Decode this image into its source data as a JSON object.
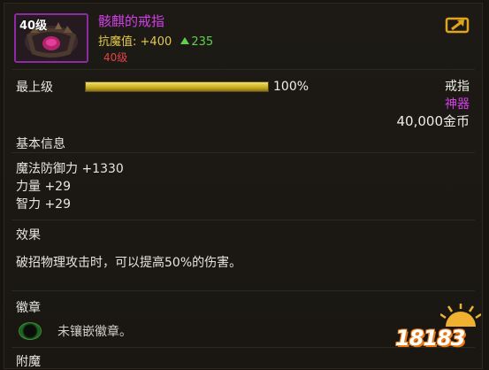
{
  "header": {
    "icon_level": "40级",
    "item_name": "骸麒的戒指",
    "stat_label": "抗魔值:",
    "stat_value": "+400",
    "stat_delta": "235",
    "required_level": "40级"
  },
  "level_row": {
    "label": "最上级",
    "progress": 1.0,
    "percent_text": "100%"
  },
  "item_info": {
    "type": "戒指",
    "rarity": "神器",
    "price": "40,000金币"
  },
  "basic_info": {
    "title": "基本信息",
    "attributes": [
      "魔法防御力 +1330",
      "力量 +29",
      "智力 +29"
    ]
  },
  "effect": {
    "title": "效果",
    "text": "破招物理攻击时，可以提高50%的伤害。"
  },
  "emblem": {
    "title": "徽章",
    "slot_text": "未镶嵌徽章。"
  },
  "enchant": {
    "title": "附魔"
  },
  "watermark": {
    "text": "18183"
  },
  "colors": {
    "rarity": "#d040e6",
    "stat": "#e3c84d",
    "increase": "#5fd04e",
    "required_level": "#e24545",
    "progress": "#d8bb33"
  }
}
